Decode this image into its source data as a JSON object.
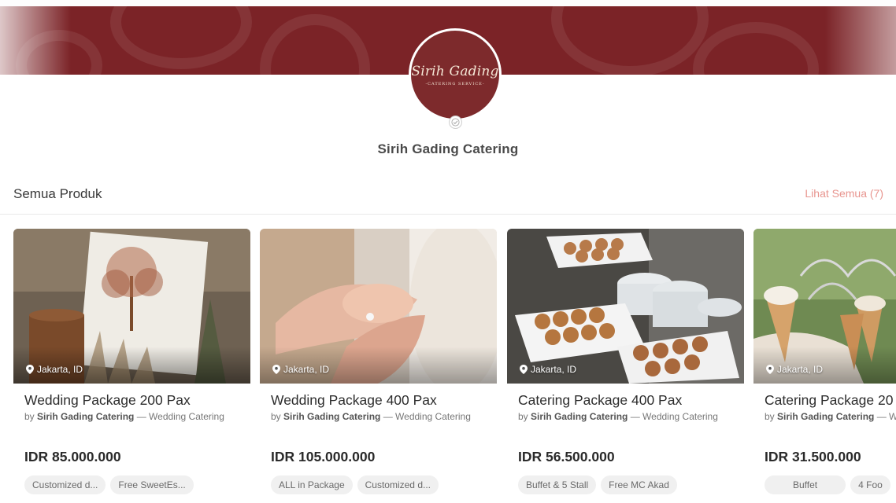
{
  "vendor": {
    "logo_script": "Sirih Gading",
    "logo_sub": "-CATERING SERVICE-",
    "name": "Sirih Gading Catering"
  },
  "section": {
    "title": "Semua Produk",
    "see_all": "Lihat Semua (7)"
  },
  "products": [
    {
      "location": "Jakarta, ID",
      "title": "Wedding Package 200 Pax",
      "by_prefix": "by ",
      "vendor": "Sirih Gading Catering",
      "category": " — Wedding Catering",
      "price": "IDR 85.000.000",
      "tags": [
        "Customized d...",
        "Free SweetEs..."
      ]
    },
    {
      "location": "Jakarta, ID",
      "title": "Wedding Package 400 Pax",
      "by_prefix": "by ",
      "vendor": "Sirih Gading Catering",
      "category": " — Wedding Catering",
      "price": "IDR 105.000.000",
      "tags": [
        "ALL in Package",
        "Customized d..."
      ]
    },
    {
      "location": "Jakarta, ID",
      "title": "Catering Package 400 Pax",
      "by_prefix": "by ",
      "vendor": "Sirih Gading Catering",
      "category": " — Wedding Catering",
      "price": "IDR 56.500.000",
      "tags": [
        "Buffet & 5 Stall",
        "Free MC Akad"
      ]
    },
    {
      "location": "Jakarta, ID",
      "title": "Catering Package 20",
      "by_prefix": "by ",
      "vendor": "Sirih Gading Catering",
      "category": " — W",
      "price": "IDR 31.500.000",
      "tags": [
        "Buffet",
        "4 Foo"
      ]
    }
  ],
  "icons": {
    "location": "map-pin-icon",
    "verified": "verified-badge-icon"
  },
  "colors": {
    "brand": "#7b2327",
    "link": "#e8958f"
  }
}
